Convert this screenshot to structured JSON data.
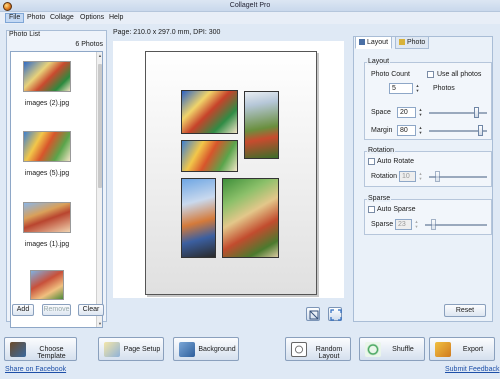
{
  "app": {
    "title": "CollageIt Pro"
  },
  "menu": [
    "File",
    "Photo",
    "Collage",
    "Options",
    "Help"
  ],
  "photo_list": {
    "title": "Photo List",
    "count": "6 Photos",
    "items": [
      {
        "label": "images (2).jpg"
      },
      {
        "label": "images (5).jpg"
      },
      {
        "label": "images (1).jpg"
      },
      {
        "label": ""
      }
    ],
    "buttons": {
      "add": "Add",
      "remove": "Remove",
      "clear": "Clear"
    }
  },
  "page_info": "Page: 210.0 x 297.0 mm, DPI: 300",
  "tabs": {
    "layout": "Layout",
    "photo": "Photo"
  },
  "layout_group": {
    "title": "Layout",
    "photo_count_label": "Photo Count",
    "use_all_label": "Use all photos",
    "photo_count_value": "5",
    "photos_unit": "Photos",
    "space_label": "Space",
    "space_value": "20",
    "margin_label": "Margin",
    "margin_value": "80",
    "space_level": 0.85,
    "margin_level": 0.92
  },
  "rotation_group": {
    "title": "Rotation",
    "auto_label": "Auto Rotate",
    "rotation_label": "Rotation",
    "rotation_value": "10"
  },
  "sparse_group": {
    "title": "Sparse",
    "auto_label": "Auto Sparse",
    "sparse_label": "Sparse",
    "sparse_value": "23"
  },
  "reset_label": "Reset",
  "bottom_buttons": {
    "choose_template": "Choose Template",
    "page_setup": "Page Setup",
    "background": "Background",
    "random_layout": "Random Layout",
    "shuffle": "Shuffle",
    "export": "Export"
  },
  "links": {
    "facebook": "Share on Facebook",
    "feedback": "Submit Feedback"
  },
  "icons": {
    "app": "app-icon",
    "layout_tab": "layout-icon",
    "photo_tab": "photo-icon",
    "fit": "fit-page-icon",
    "expand": "expand-icon",
    "choose_template": "template-icon",
    "page_setup": "page-setup-icon",
    "background": "background-icon",
    "random_layout": "random-layout-icon",
    "shuffle": "shuffle-icon",
    "export": "export-icon"
  }
}
